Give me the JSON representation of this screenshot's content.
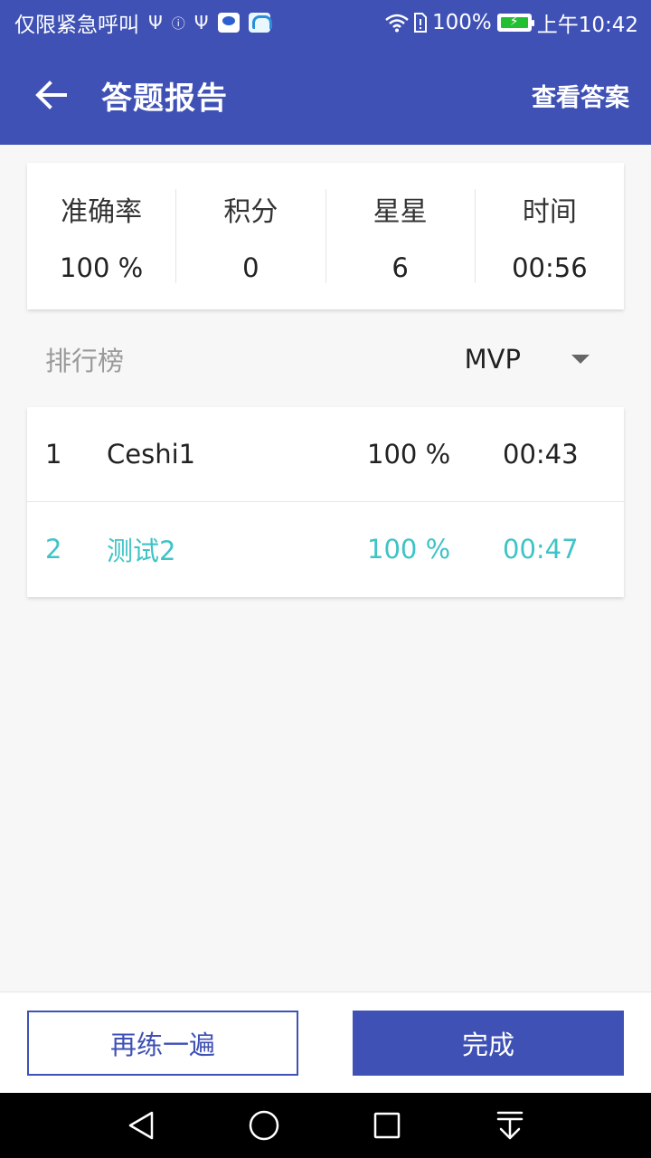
{
  "status_bar": {
    "left_text": "仅限紧急呼叫",
    "battery": "100%",
    "time": "上午10:42"
  },
  "app_bar": {
    "title": "答题报告",
    "action": "查看答案"
  },
  "stats": [
    {
      "label": "准确率",
      "value": "100 %"
    },
    {
      "label": "积分",
      "value": "0"
    },
    {
      "label": "星星",
      "value": "6"
    },
    {
      "label": "时间",
      "value": "00:56"
    }
  ],
  "ranking": {
    "title": "排行榜",
    "filter": "MVP",
    "rows": [
      {
        "rank": "1",
        "name": "Ceshi1",
        "accuracy": "100 %",
        "time": "00:43"
      },
      {
        "rank": "2",
        "name": "测试2",
        "accuracy": "100 %",
        "time": "00:47"
      }
    ]
  },
  "buttons": {
    "retry": "再练一遍",
    "done": "完成"
  },
  "colors": {
    "primary": "#3f51b5",
    "highlight": "#3ec3c7",
    "background": "#f7f7f7"
  }
}
